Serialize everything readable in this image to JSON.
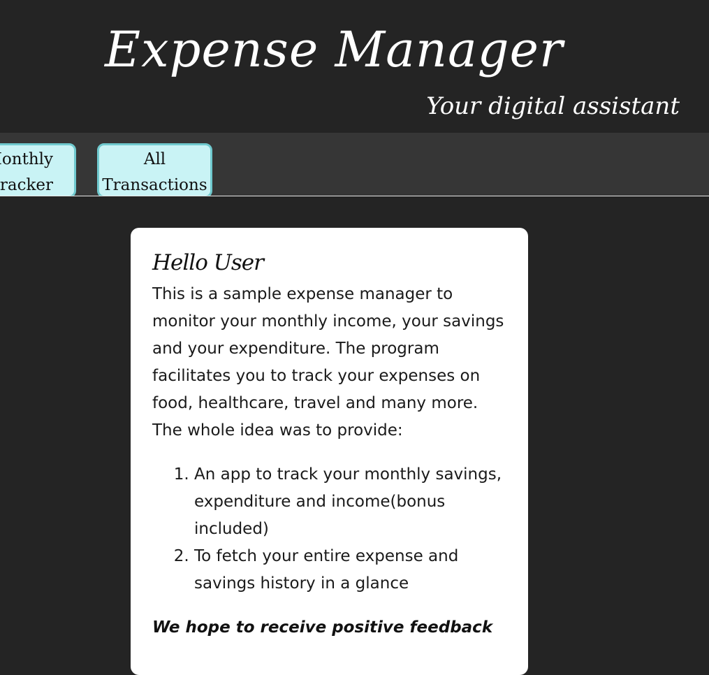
{
  "header": {
    "title": "Expense Manager",
    "subtitle": "Your digital assistant"
  },
  "nav": {
    "tabs": [
      {
        "line1": "Monthly",
        "line2": "Tracker"
      },
      {
        "line1": "All",
        "line2": "Transactions"
      }
    ]
  },
  "welcome": {
    "heading": "Hello User",
    "intro": "This is a sample expense manager to monitor your monthly income, your savings and your expenditure. The program facilitates you to track your expenses on food, healthcare, travel and many more. The whole idea was to provide:",
    "goals": [
      "An app to track your monthly savings, expenditure and income(bonus included)",
      "To fetch your entire expense and savings history in a glance"
    ],
    "feedback": "We hope to receive positive feedback"
  },
  "colors": {
    "background": "#242424",
    "navbar": "#363636",
    "tab_fill": "#c9f3f5",
    "tab_border": "#6fc9ce",
    "card": "#ffffff"
  }
}
